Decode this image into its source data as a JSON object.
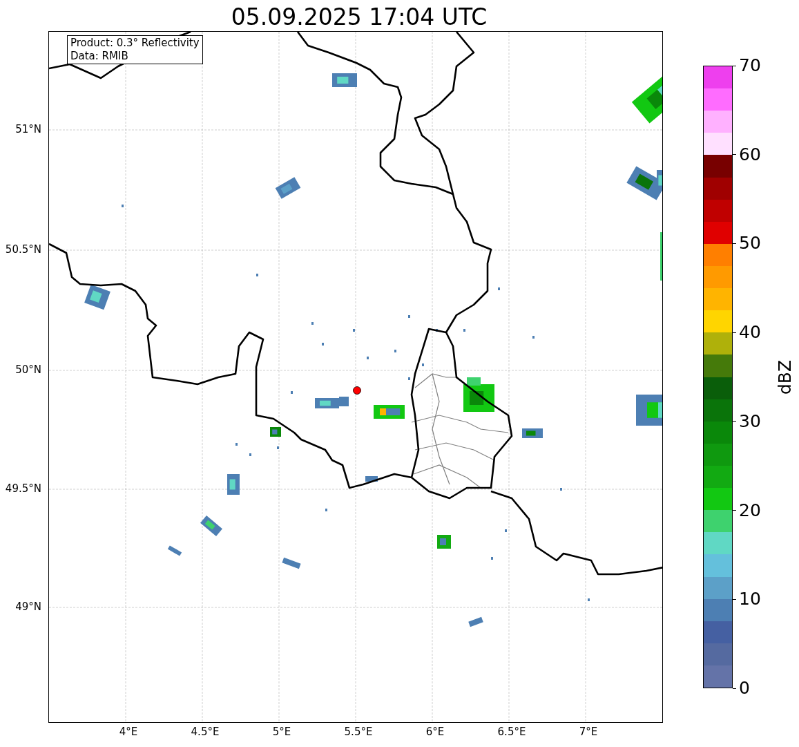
{
  "title": "05.09.2025 17:04 UTC",
  "info_box": [
    "Product: 0.3° Reflectivity",
    "Data: RMIB"
  ],
  "lat_labels": [
    "51°N",
    "50.5°N",
    "50°N",
    "49.5°N",
    "49°N"
  ],
  "lon_labels": [
    "4°E",
    "4.5°E",
    "5°E",
    "5.5°E",
    "6°E",
    "6.5°E",
    "7°E"
  ],
  "colorbar": {
    "label": "dBZ",
    "ticks": [
      "70",
      "60",
      "50",
      "40",
      "30",
      "20",
      "10",
      "0"
    ],
    "segments": [
      {
        "color": "#ee3fee"
      },
      {
        "color": "#ff6cff"
      },
      {
        "color": "#ffb1ff"
      },
      {
        "color": "#ffe0ff"
      },
      {
        "color": "#780000"
      },
      {
        "color": "#a00000"
      },
      {
        "color": "#c00000"
      },
      {
        "color": "#e00000"
      },
      {
        "color": "#ff7f00"
      },
      {
        "color": "#ff9a00"
      },
      {
        "color": "#ffb400"
      },
      {
        "color": "#ffd500"
      },
      {
        "color": "#afb10a"
      },
      {
        "color": "#457a0a"
      },
      {
        "color": "#0a5e0a"
      },
      {
        "color": "#0a740a"
      },
      {
        "color": "#0a880a"
      },
      {
        "color": "#0f990f"
      },
      {
        "color": "#12aa12"
      },
      {
        "color": "#12c812"
      },
      {
        "color": "#3ed26e"
      },
      {
        "color": "#60d8c4"
      },
      {
        "color": "#64c0dc"
      },
      {
        "color": "#5ca0c8"
      },
      {
        "color": "#4d7fb3"
      },
      {
        "color": "#4560a2"
      },
      {
        "color": "#556aa0"
      },
      {
        "color": "#6473a8"
      }
    ]
  }
}
